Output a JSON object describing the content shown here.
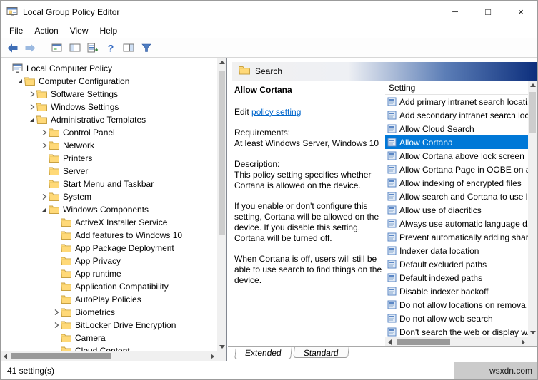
{
  "colors": {
    "accent": "#0078d7",
    "link": "#0066cc",
    "banner_blue": "#0c2e7c",
    "folder_yellow": "#ffd978"
  },
  "titlebar": {
    "title": "Local Group Policy Editor",
    "minimize": "─",
    "maximize": "□",
    "close": "×"
  },
  "menu": {
    "items": [
      "File",
      "Action",
      "View",
      "Help"
    ]
  },
  "toolbar": {
    "buttons": [
      {
        "name": "back-button",
        "icon": "arrow-left-icon"
      },
      {
        "name": "forward-button",
        "icon": "arrow-right-icon"
      },
      {
        "name": "up-one-level-button",
        "icon": "window-icon"
      },
      {
        "name": "show-console-tree-button",
        "icon": "panes-icon"
      },
      {
        "name": "export-list-button",
        "icon": "export-list-icon"
      },
      {
        "name": "help-button",
        "icon": "help-icon"
      },
      {
        "name": "show-action-pane-button",
        "icon": "panes-right-icon"
      },
      {
        "name": "filter-button",
        "icon": "filter-icon"
      }
    ]
  },
  "tree": {
    "items": [
      {
        "label": "Local Computer Policy",
        "depth": 0,
        "icon": "console",
        "expander": "none"
      },
      {
        "label": "Computer Configuration",
        "depth": 1,
        "icon": "folder",
        "expander": "expanded"
      },
      {
        "label": "Software Settings",
        "depth": 2,
        "icon": "folder",
        "expander": "collapsed"
      },
      {
        "label": "Windows Settings",
        "depth": 2,
        "icon": "folder",
        "expander": "collapsed"
      },
      {
        "label": "Administrative Templates",
        "depth": 2,
        "icon": "folder",
        "expander": "expanded"
      },
      {
        "label": "Control Panel",
        "depth": 3,
        "icon": "folder",
        "expander": "collapsed"
      },
      {
        "label": "Network",
        "depth": 3,
        "icon": "folder",
        "expander": "collapsed"
      },
      {
        "label": "Printers",
        "depth": 3,
        "icon": "folder",
        "expander": "none"
      },
      {
        "label": "Server",
        "depth": 3,
        "icon": "folder",
        "expander": "none"
      },
      {
        "label": "Start Menu and Taskbar",
        "depth": 3,
        "icon": "folder",
        "expander": "none"
      },
      {
        "label": "System",
        "depth": 3,
        "icon": "folder",
        "expander": "collapsed"
      },
      {
        "label": "Windows Components",
        "depth": 3,
        "icon": "folder",
        "expander": "expanded"
      },
      {
        "label": "ActiveX Installer Service",
        "depth": 4,
        "icon": "folder",
        "expander": "none"
      },
      {
        "label": "Add features to Windows 10",
        "depth": 4,
        "icon": "folder",
        "expander": "none"
      },
      {
        "label": "App Package Deployment",
        "depth": 4,
        "icon": "folder",
        "expander": "none"
      },
      {
        "label": "App Privacy",
        "depth": 4,
        "icon": "folder",
        "expander": "none"
      },
      {
        "label": "App runtime",
        "depth": 4,
        "icon": "folder",
        "expander": "none"
      },
      {
        "label": "Application Compatibility",
        "depth": 4,
        "icon": "folder",
        "expander": "none"
      },
      {
        "label": "AutoPlay Policies",
        "depth": 4,
        "icon": "folder",
        "expander": "none"
      },
      {
        "label": "Biometrics",
        "depth": 4,
        "icon": "folder",
        "expander": "collapsed"
      },
      {
        "label": "BitLocker Drive Encryption",
        "depth": 4,
        "icon": "folder",
        "expander": "collapsed"
      },
      {
        "label": "Camera",
        "depth": 4,
        "icon": "folder",
        "expander": "none"
      },
      {
        "label": "Cloud Content",
        "depth": 4,
        "icon": "folder",
        "expander": "none"
      }
    ]
  },
  "details": {
    "header": "Search",
    "policy_title": "Allow Cortana",
    "edit_prefix": "Edit ",
    "edit_link": "policy setting",
    "requirements_label": "Requirements:",
    "requirements_text": "At least Windows Server, Windows 10",
    "description_label": "Description:",
    "paragraphs": [
      "This policy setting specifies whether Cortana is allowed on the device.",
      "If you enable or don't configure this setting, Cortana will be allowed on the device. If you disable this setting, Cortana will be turned off.",
      "When Cortana is off, users will still be able to use search to find things on the device."
    ]
  },
  "settings": {
    "column_header": "Setting",
    "selected_index": 3,
    "items": [
      "Add primary intranet search locati...",
      "Add secondary intranet search loc...",
      "Allow Cloud Search",
      "Allow Cortana",
      "Allow Cortana above lock screen",
      "Allow Cortana Page in OOBE on a...",
      "Allow indexing of encrypted files",
      "Allow search and Cortana to use l...",
      "Allow use of diacritics",
      "Always use automatic language d...",
      "Prevent automatically adding shar...",
      "Indexer data location",
      "Default excluded paths",
      "Default indexed paths",
      "Disable indexer backoff",
      "Do not allow locations on remova...",
      "Do not allow web search",
      "Don't search the web or display w..."
    ]
  },
  "tabs": {
    "items": [
      "Extended",
      "Standard"
    ],
    "active_index": 0
  },
  "statusbar": {
    "text": "41 setting(s)"
  },
  "watermark": "wsxdn.com"
}
